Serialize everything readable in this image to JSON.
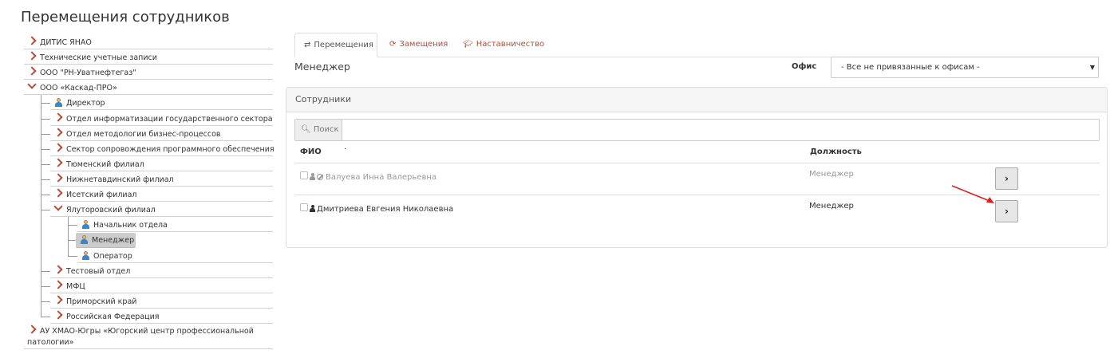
{
  "page": {
    "title": "Перемещения сотрудников"
  },
  "tree": {
    "nodes": [
      {
        "label": "ДИТИС ЯНАО"
      },
      {
        "label": "Технические учетные записи"
      },
      {
        "label": "ООО \"РН-Уватнефтегаз\""
      },
      {
        "label": "ООО «Каскад-ПРО»"
      },
      {
        "label": "Директор"
      },
      {
        "label": "Отдел информатизации государственного сектора"
      },
      {
        "label": "Отдел методологии бизнес-процессов"
      },
      {
        "label": "Сектор сопровождения программного обеспечения"
      },
      {
        "label": "Тюменский филиал"
      },
      {
        "label": "Нижнетавдинский филиал"
      },
      {
        "label": "Исетский филиал"
      },
      {
        "label": "Ялуторовский филиал"
      },
      {
        "label": "Начальник отдела"
      },
      {
        "label": "Менеджер"
      },
      {
        "label": "Оператор"
      },
      {
        "label": "Тестовый отдел"
      },
      {
        "label": "МФЦ"
      },
      {
        "label": "Приморский край"
      },
      {
        "label": "Российская Федерация"
      },
      {
        "label": "АУ ХМАО-Югры «Югорский центр профессиональной"
      },
      {
        "label": "патологии»"
      }
    ]
  },
  "tabs": [
    {
      "label": "Перемещения",
      "icon": "exchange-icon"
    },
    {
      "label": "Замещения",
      "icon": "refresh-icon"
    },
    {
      "label": "Наставничество",
      "icon": "graduation-cap-icon"
    }
  ],
  "header": {
    "position_title": "Менеджер",
    "office_label": "Офис",
    "office_value": "- Все не привязанные к офисам -"
  },
  "panel": {
    "title": "Сотрудники",
    "search_label": "Поиск",
    "columns": {
      "name": "ФИО",
      "dot": "·",
      "position": "Должность"
    },
    "rows": [
      {
        "name": "Валуева Инна Валерьевна",
        "position": "Менеджер",
        "disabled": true
      },
      {
        "name": "Дмитриева Евгения Николаевна",
        "position": "Менеджер",
        "disabled": false
      }
    ],
    "go_label": "›"
  },
  "colors": {
    "accent": "#b94a33",
    "arrow": "#e02020"
  }
}
